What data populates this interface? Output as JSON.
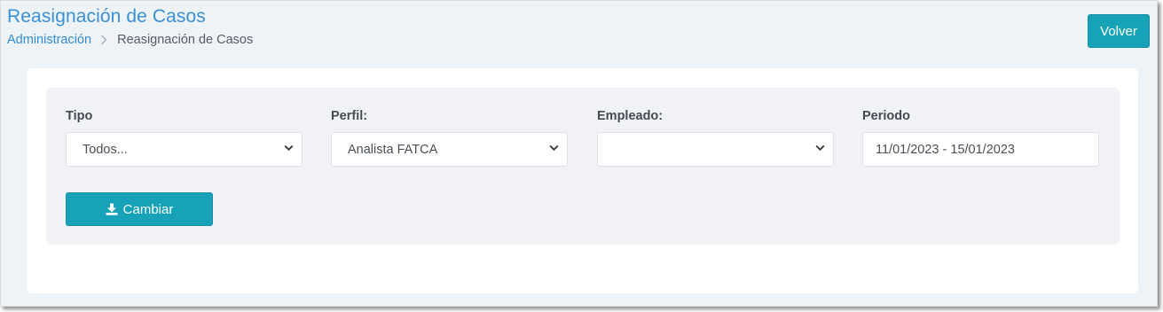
{
  "header": {
    "title": "Reasignación de Casos",
    "breadcrumb": {
      "parent": "Administración",
      "separator_icon": "chevron-right-icon",
      "current": "Reasignación de Casos"
    },
    "back_button_label": "Volver"
  },
  "filters": {
    "tipo": {
      "label": "Tipo",
      "value": "Todos..."
    },
    "perfil": {
      "label": "Perfil:",
      "value": "Analista FATCA"
    },
    "empleado": {
      "label": "Empleado:",
      "value": ""
    },
    "periodo": {
      "label": "Periodo",
      "value": "11/01/2023 - 15/01/2023"
    }
  },
  "actions": {
    "change_button_label": "Cambiar",
    "change_button_icon": "download-icon"
  },
  "colors": {
    "accent": "#17a2b8",
    "title": "#3a8fd6",
    "background": "#eef3f7"
  }
}
